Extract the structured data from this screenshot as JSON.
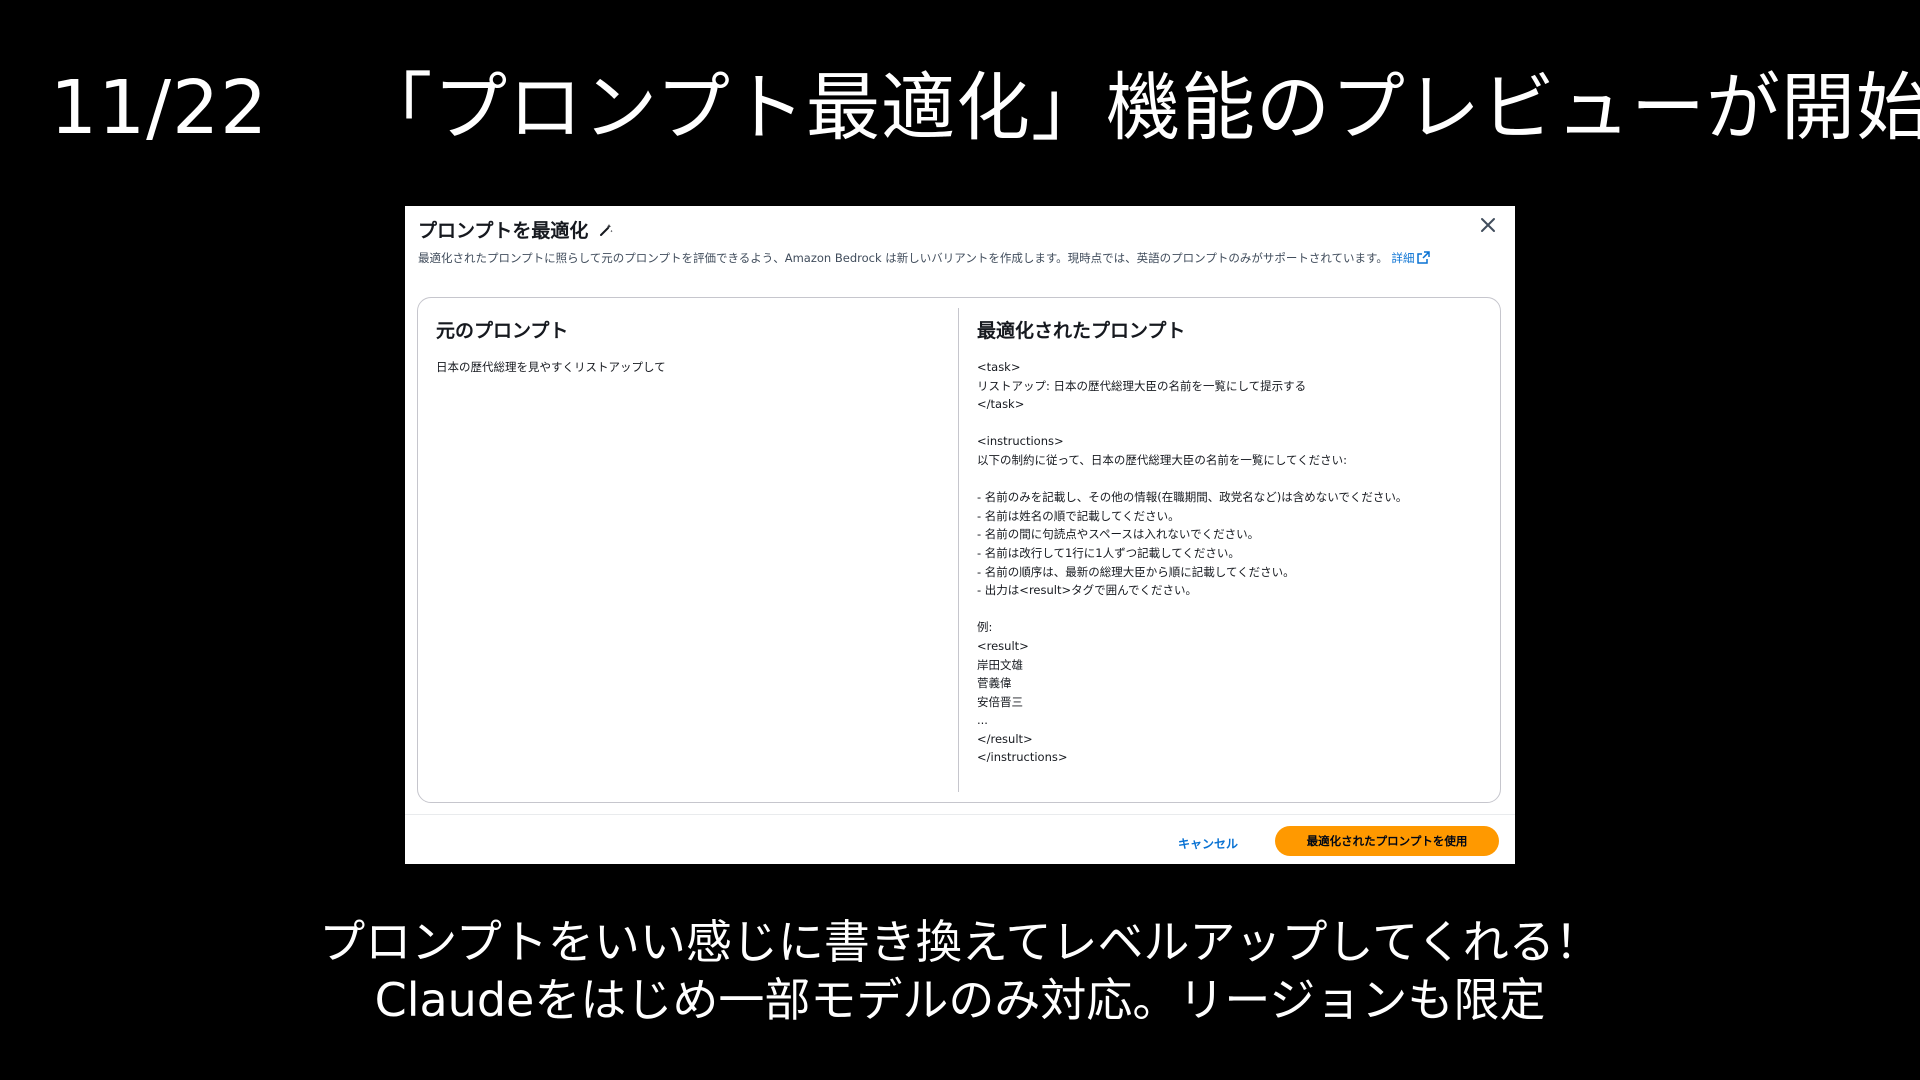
{
  "slide": {
    "date": "11/22",
    "title": "「プロンプト最適化」機能のプレビューが開始",
    "caption_line1": "プロンプトをいい感じに書き換えてレベルアップしてくれる！",
    "caption_line2": "Claudeをはじめ一部モデルのみ対応。リージョンも限定"
  },
  "modal": {
    "title": "プロンプトを最適化",
    "description": "最適化されたプロンプトに照らして元のプロンプトを評価できるよう、Amazon Bedrock は新しいバリアントを作成します。現時点では、英語のプロンプトのみがサポートされています。",
    "learn_more": "詳細",
    "original": {
      "heading": "元のプロンプト",
      "text": "日本の歴代総理を見やすくリストアップして"
    },
    "optimized": {
      "heading": "最適化されたプロンプト",
      "text": "<task>\nリストアップ: 日本の歴代総理大臣の名前を一覧にして提示する\n</task>\n\n<instructions>\n以下の制約に従って、日本の歴代総理大臣の名前を一覧にしてください:\n\n- 名前のみを記載し、その他の情報(在職期間、政党名など)は含めないでください。\n- 名前は姓名の順で記載してください。\n- 名前の間に句読点やスペースは入れないでください。\n- 名前は改行して1行に1人ずつ記載してください。\n- 名前の順序は、最新の総理大臣から順に記載してください。\n- 出力は<result>タグで囲んでください。\n\n例:\n<result>\n岸田文雄\n菅義偉\n安倍晋三\n...\n</result>\n</instructions>"
    },
    "cancel_label": "キャンセル",
    "use_label": "最適化されたプロンプトを使用"
  },
  "colors": {
    "background": "#000000",
    "accent_button": "#ff9900",
    "link": "#0972d3"
  }
}
